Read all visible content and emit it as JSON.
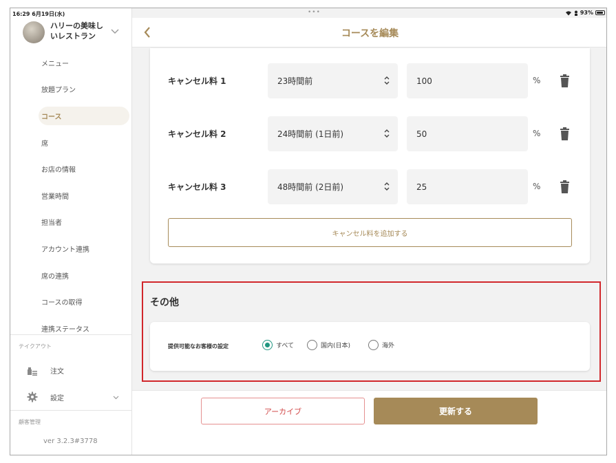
{
  "status_bar": {
    "time": "16:29",
    "date": "6月19日(水)",
    "dots": "•••",
    "battery": "93%"
  },
  "store": {
    "name": "ハリーの美味しいレストラン"
  },
  "sidebar": {
    "items": [
      {
        "label": "メニュー",
        "active": false
      },
      {
        "label": "放題プラン",
        "active": false
      },
      {
        "label": "コース",
        "active": true
      },
      {
        "label": "席",
        "active": false
      },
      {
        "label": "お店の情報",
        "active": false
      },
      {
        "label": "営業時間",
        "active": false
      },
      {
        "label": "担当者",
        "active": false
      },
      {
        "label": "アカウント連携",
        "active": false
      },
      {
        "label": "席の連携",
        "active": false
      },
      {
        "label": "コースの取得",
        "active": false
      },
      {
        "label": "連携ステータス",
        "active": false
      }
    ],
    "takeout_section": "テイクアウト",
    "orders_label": "注文",
    "settings_label": "設定",
    "customer_section": "顧客管理",
    "version": "ver 3.2.3#3778"
  },
  "header": {
    "title": "コースを編集"
  },
  "cancel_fees": [
    {
      "label": "キャンセル料 1",
      "timing": "23時間前",
      "percent": "100",
      "unit": "%"
    },
    {
      "label": "キャンセル料 2",
      "timing": "24時間前 (1日前)",
      "percent": "50",
      "unit": "%"
    },
    {
      "label": "キャンセル料 3",
      "timing": "48時間前 (2日前)",
      "percent": "25",
      "unit": "%"
    }
  ],
  "add_cancel_fee_label": "キャンセル料を追加する",
  "other": {
    "title": "その他",
    "customer_setting_label": "提供可能なお客様の設定",
    "options": [
      {
        "label": "すべて",
        "checked": true
      },
      {
        "label": "国内(日本)",
        "checked": false
      },
      {
        "label": "海外",
        "checked": false
      }
    ]
  },
  "footer": {
    "archive_label": "アーカイブ",
    "update_label": "更新する"
  },
  "colors": {
    "accent": "#a68a58",
    "radio_checked": "#1f9680",
    "highlight_border": "#d1262b",
    "archive_text": "#d24a4a"
  }
}
